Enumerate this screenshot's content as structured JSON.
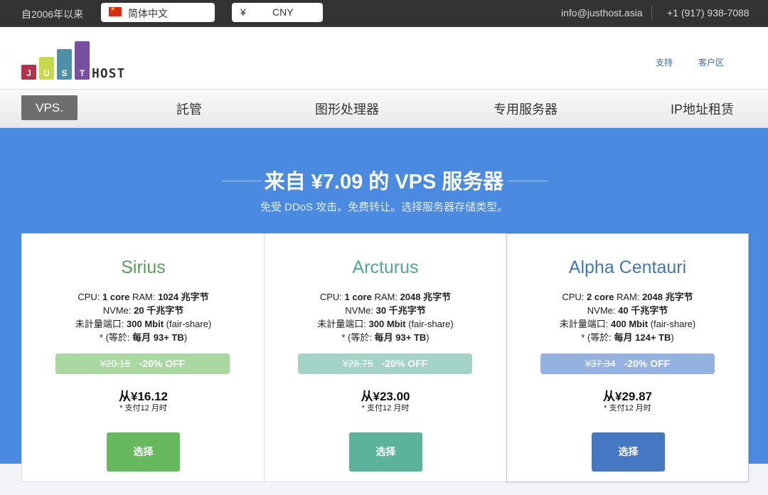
{
  "topbar": {
    "since": "自2006年以来",
    "language": "简体中文",
    "currency_symbol": "¥",
    "currency": "CNY",
    "email": "info@justhost.asia",
    "phone": "+1 (917) 938-7088"
  },
  "logo": {
    "letters": [
      "J",
      "U",
      "S",
      "T"
    ],
    "host": "HOST"
  },
  "header_links": {
    "support": "支持",
    "client_area": "客户区"
  },
  "nav": {
    "vps": "VPS.",
    "colocation": "託管",
    "gpu": "图形处理器",
    "dedicated": "专用服务器",
    "ip_rental": "IP地址租赁"
  },
  "hero": {
    "title": "来自 ¥7.09 的 VPS 服务器",
    "subtitle": "免受 DDoS 攻击。免费转让。选择服务器存储类型。"
  },
  "plans": [
    {
      "name": "Sirius",
      "name_color": "#5a9e5a",
      "cpu_label": "CPU: ",
      "cpu": "1 core",
      "ram_label": " RAM: ",
      "ram": "1024 兆字节",
      "nvme_label": "NVMe: ",
      "nvme": "20 千兆字节",
      "port_label": "未計量端口: ",
      "port": "300 Mbit",
      "port_note": " (fair-share)",
      "traffic_prefix": "* (等於: ",
      "traffic": "每月 93+ TB",
      "traffic_suffix": ")",
      "old_price": "¥20.15",
      "discount": "-20% OFF",
      "discount_color": "#a8d8a0",
      "price": "从¥16.12",
      "term": "*  支付12 月时",
      "button": "选择",
      "button_color": "#67b95e"
    },
    {
      "name": "Arcturus",
      "name_color": "#4fa890",
      "cpu_label": "CPU: ",
      "cpu": "1 core",
      "ram_label": " RAM: ",
      "ram": "2048 兆字节",
      "nvme_label": "NVMe: ",
      "nvme": "30 千兆字节",
      "port_label": "未計量端口: ",
      "port": "300 Mbit",
      "port_note": " (fair-share)",
      "traffic_prefix": "* (等於: ",
      "traffic": "每月 93+ TB",
      "traffic_suffix": ")",
      "old_price": "¥28.75",
      "discount": "-20% OFF",
      "discount_color": "#a3d3c6",
      "price": "从¥23.00",
      "term": "*  支付12 月时",
      "button": "选择",
      "button_color": "#5bb39c"
    },
    {
      "name": "Alpha Centauri",
      "name_color": "#3f78c0",
      "cpu_label": "CPU: ",
      "cpu": "2 core",
      "ram_label": " RAM: ",
      "ram": "2048 兆字节",
      "nvme_label": "NVMe: ",
      "nvme": "40 千兆字节",
      "port_label": "未計量端口: ",
      "port": "400 Mbit",
      "port_note": " (fair-share)",
      "traffic_prefix": "* (等於: ",
      "traffic": "每月 124+ TB",
      "traffic_suffix": ")",
      "old_price": "¥37.34",
      "discount": "-20% OFF",
      "discount_color": "#93b2e0",
      "price": "从¥29.87",
      "term": "*  支付12 月时",
      "button": "选择",
      "button_color": "#4577c2"
    }
  ]
}
